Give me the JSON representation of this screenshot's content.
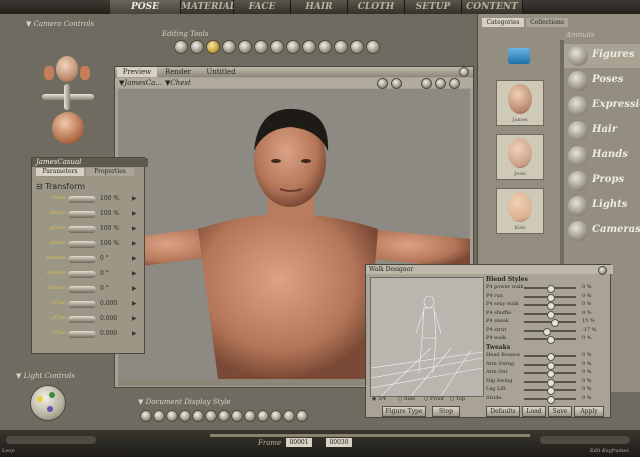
{
  "tabs": [
    "POSE",
    "MATERIAL",
    "FACE",
    "HAIR",
    "CLOTH",
    "SETUP",
    "CONTENT"
  ],
  "active_tab": "POSE",
  "camera_controls_label": "Camera Controls",
  "editing_tools_label": "Editing Tools",
  "document": {
    "tabs": [
      "Preview",
      "Render",
      "Untitled"
    ],
    "figure_menu": "JamesCa...",
    "part_menu": "Chest"
  },
  "params": {
    "title": "JamesCasual",
    "tabs": [
      "Parameters",
      "Properties"
    ],
    "section": "Transform",
    "rows": [
      {
        "label": "Scale",
        "value": "100 %"
      },
      {
        "label": "xScale",
        "value": "100 %"
      },
      {
        "label": "yScale",
        "value": "100 %"
      },
      {
        "label": "zScale",
        "value": "100 %"
      },
      {
        "label": "yRotate",
        "value": "0 °"
      },
      {
        "label": "xRotate",
        "value": "0 °"
      },
      {
        "label": "zRotate",
        "value": "0 °"
      },
      {
        "label": "xTran",
        "value": "0.000"
      },
      {
        "label": "yTran",
        "value": "0.000"
      },
      {
        "label": "zTran",
        "value": "0.000"
      }
    ]
  },
  "light_controls_label": "Light Controls",
  "document_display_label": "Document Display Style",
  "library": {
    "tabs": [
      "Categories",
      "Collections"
    ],
    "subheader": "Animals",
    "categories": [
      "Figures",
      "Poses",
      "Expression",
      "Hair",
      "Hands",
      "Props",
      "Lights",
      "Cameras"
    ],
    "thumbnails": [
      "James",
      "Jessi",
      "Kids"
    ]
  },
  "walk_designer": {
    "title": "Walk Designer",
    "blend_header": "Blend Styles",
    "blend_rows": [
      {
        "label": "P4 power walk",
        "value": "0 %",
        "level": 0.5
      },
      {
        "label": "P4 run",
        "value": "0 %",
        "level": 0.5
      },
      {
        "label": "P4 sexy walk",
        "value": "0 %",
        "level": 0.5
      },
      {
        "label": "P4 shuffle",
        "value": "0 %",
        "level": 0.5
      },
      {
        "label": "P4 sneak",
        "value": "15 %",
        "level": 0.58
      },
      {
        "label": "P4 strut",
        "value": "-17 %",
        "level": 0.42
      },
      {
        "label": "P4 walk",
        "value": "0 %",
        "level": 0.5
      }
    ],
    "tweaks_header": "Tweaks",
    "tweak_rows": [
      {
        "label": "Head Bounce",
        "value": "0 %",
        "level": 0.5
      },
      {
        "label": "Arm Swing",
        "value": "0 %",
        "level": 0.5
      },
      {
        "label": "Arm Out",
        "value": "0 %",
        "level": 0.5
      },
      {
        "label": "Hip Swing",
        "value": "0 %",
        "level": 0.5
      },
      {
        "label": "Leg Lift",
        "value": "0 %",
        "level": 0.5
      },
      {
        "label": "Stride",
        "value": "0 %",
        "level": 0.5
      }
    ],
    "views": [
      "3/4",
      "Side",
      "Front",
      "Top"
    ],
    "buttons": [
      "Figure Type",
      "Stop",
      "Defaults",
      "Load",
      "Save",
      "Apply"
    ]
  },
  "frame": {
    "label": "Frame",
    "current": "00001",
    "total": "00030"
  },
  "loop_label": "Loop",
  "keyframes_label": "Edit Keyframes"
}
